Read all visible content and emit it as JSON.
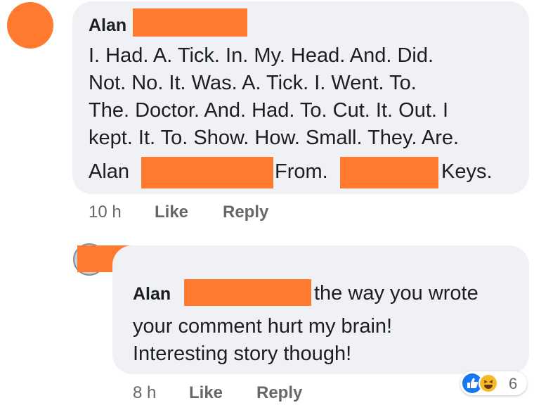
{
  "comment": {
    "author": "Alan",
    "lines": [
      "I. Had. A. Tick. In. My. Head. And. Did.",
      "Not. No. It. Was. A. Tick. I. Went. To.",
      "The. Doctor. And. Had. To. Cut. It. Out. I",
      "kept. It. To. Show. How. Small. They. Are."
    ],
    "last_line": {
      "part1": "Alan",
      "part2": "From.",
      "part3": "Keys."
    },
    "time": "10 h",
    "like_label": "Like",
    "reply_label": "Reply"
  },
  "reply": {
    "author": "Alan",
    "lines": [
      "the way you wrote",
      "your comment hurt my brain!",
      "Interesting story though!"
    ],
    "time": "8 h",
    "like_label": "Like",
    "reply_label": "Reply",
    "reaction_count": "6",
    "reactions": [
      "like-icon",
      "haha-icon"
    ]
  },
  "colors": {
    "redaction": "#ff7a2f",
    "bubble": "#eff1f5",
    "meta_text": "#65676b",
    "like_blue": "#1877f2",
    "haha_yellow": "#f7b928"
  }
}
